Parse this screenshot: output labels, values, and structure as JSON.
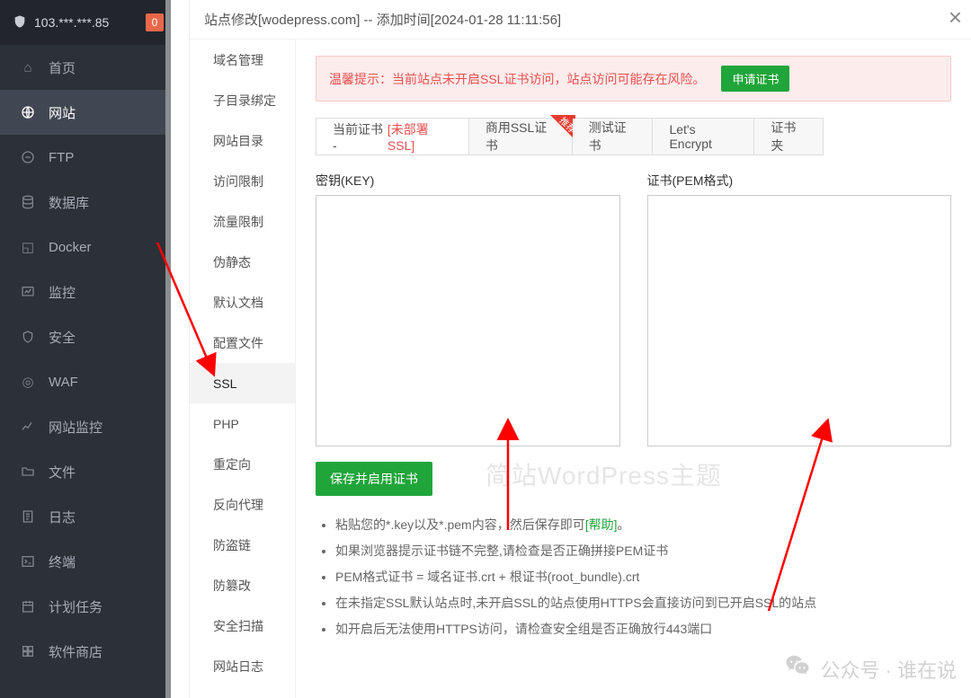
{
  "nav": {
    "header_ip": "103.***.***.85",
    "header_badge": "0",
    "items": [
      {
        "icon": "home",
        "label": "首页"
      },
      {
        "icon": "globe",
        "label": "网站",
        "active": true
      },
      {
        "icon": "ftp",
        "label": "FTP"
      },
      {
        "icon": "db",
        "label": "数据库"
      },
      {
        "icon": "docker",
        "label": "Docker"
      },
      {
        "icon": "monitor",
        "label": "监控"
      },
      {
        "icon": "shield",
        "label": "安全"
      },
      {
        "icon": "waf",
        "label": "WAF"
      },
      {
        "icon": "sitemon",
        "label": "网站监控"
      },
      {
        "icon": "folder",
        "label": "文件"
      },
      {
        "icon": "log",
        "label": "日志"
      },
      {
        "icon": "terminal",
        "label": "终端"
      },
      {
        "icon": "cron",
        "label": "计划任务"
      },
      {
        "icon": "store",
        "label": "软件商店"
      }
    ]
  },
  "modal": {
    "title": "站点修改[wodepress.com] -- 添加时间[2024-01-28 11:11:56]",
    "close": "×"
  },
  "settings": {
    "items": [
      "域名管理",
      "子目录绑定",
      "网站目录",
      "访问限制",
      "流量限制",
      "伪静态",
      "默认文档",
      "配置文件",
      "SSL",
      "PHP",
      "重定向",
      "反向代理",
      "防盗链",
      "防篡改",
      "安全扫描",
      "网站日志"
    ],
    "active_index": 8
  },
  "alert": {
    "text": "温馨提示：当前站点未开启SSL证书访问，站点访问可能存在风险。",
    "btn": "申请证书"
  },
  "tabs": {
    "items": [
      {
        "label": "当前证书 - ",
        "suffix": "[未部署SSL]",
        "active": true
      },
      {
        "label": "商用SSL证书",
        "ribbon": "推荐"
      },
      {
        "label": "测试证书"
      },
      {
        "label": "Let's Encrypt"
      },
      {
        "label": "证书夹"
      }
    ]
  },
  "cert": {
    "key_label": "密钥(KEY)",
    "pem_label": "证书(PEM格式)",
    "save_btn": "保存并启用证书"
  },
  "notes": {
    "n1a": "粘贴您的*.key以及*.pem内容，然后保存即可",
    "n1help": "[帮助]",
    "n1b": "。",
    "n2": "如果浏览器提示证书链不完整,请检查是否正确拼接PEM证书",
    "n3": "PEM格式证书 = 域名证书.crt + 根证书(root_bundle).crt",
    "n4": "在未指定SSL默认站点时,未开启SSL的站点使用HTTPS会直接访问到已开启SSL的站点",
    "n5": "如开启后无法使用HTTPS访问，请检查安全组是否正确放行443端口"
  },
  "watermark": {
    "center": "简站WordPress主题",
    "bottom": "公众号 · 谁在说"
  }
}
